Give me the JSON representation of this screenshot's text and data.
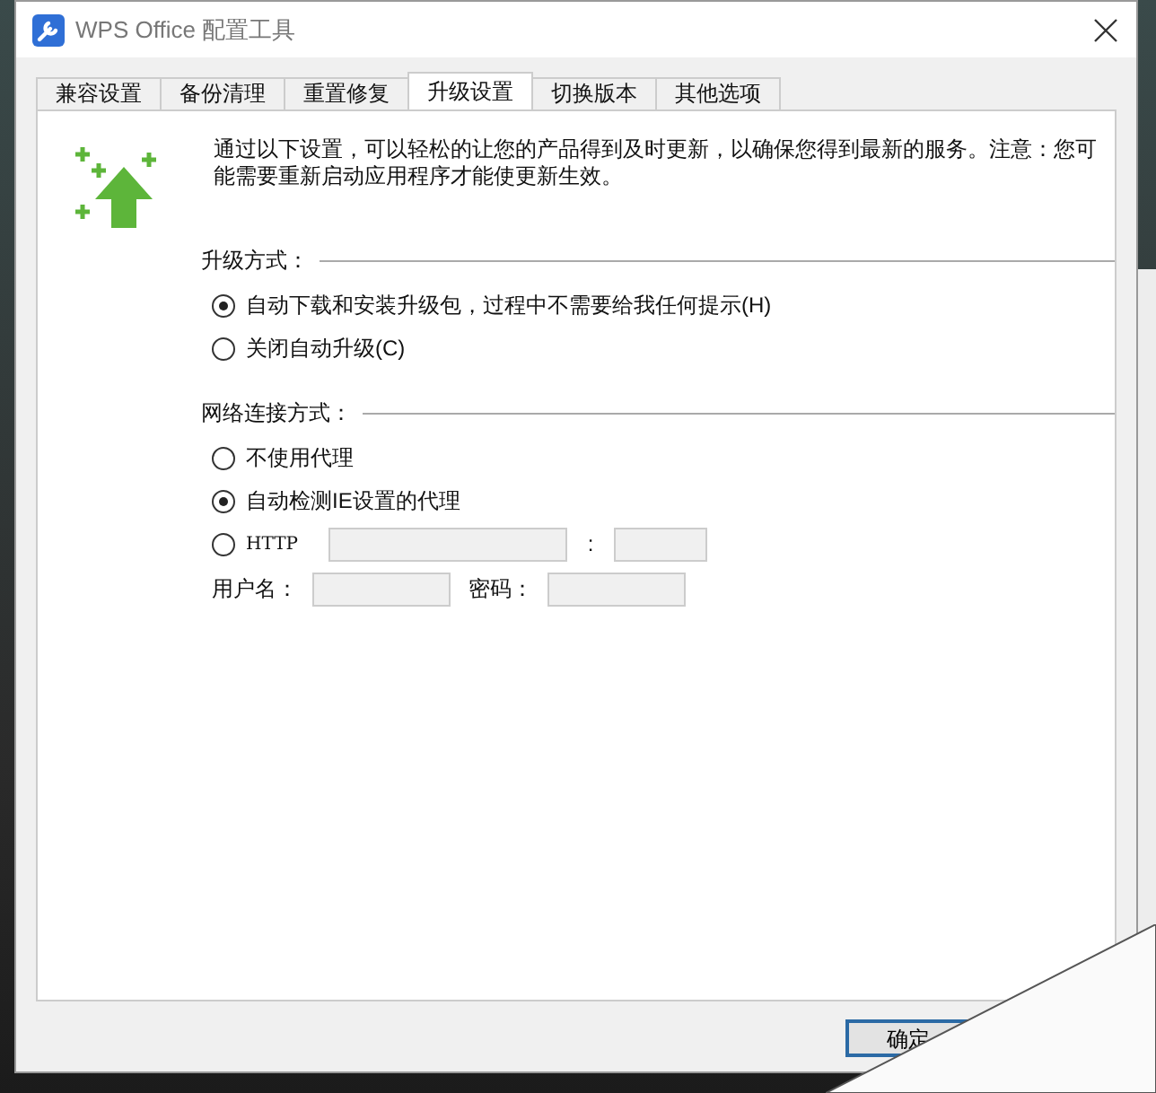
{
  "window": {
    "title": "WPS Office 配置工具"
  },
  "tabs": [
    {
      "label": "兼容设置",
      "selected": false
    },
    {
      "label": "备份清理",
      "selected": false
    },
    {
      "label": "重置修复",
      "selected": false
    },
    {
      "label": "升级设置",
      "selected": true
    },
    {
      "label": "切换版本",
      "selected": false
    },
    {
      "label": "其他选项",
      "selected": false
    }
  ],
  "intro": "通过以下设置，可以轻松的让您的产品得到及时更新，以确保您得到最新的服务。注意：您可能需要重新启动应用程序才能使更新生效。",
  "upgrade_mode": {
    "label": "升级方式：",
    "options": [
      {
        "label": "自动下载和安装升级包，过程中不需要给我任何提示(H)",
        "selected": true
      },
      {
        "label": "关闭自动升级(C)",
        "selected": false
      }
    ]
  },
  "network": {
    "label": "网络连接方式：",
    "options": [
      {
        "label": "不使用代理",
        "selected": false,
        "kind": "plain"
      },
      {
        "label": "自动检测IE设置的代理",
        "selected": true,
        "kind": "plain"
      },
      {
        "label": "HTTP",
        "selected": false,
        "kind": "address"
      }
    ],
    "port_separator": ":",
    "username_label": "用户名：",
    "password_label": "密码："
  },
  "buttons": [
    {
      "label": "确定"
    }
  ]
}
